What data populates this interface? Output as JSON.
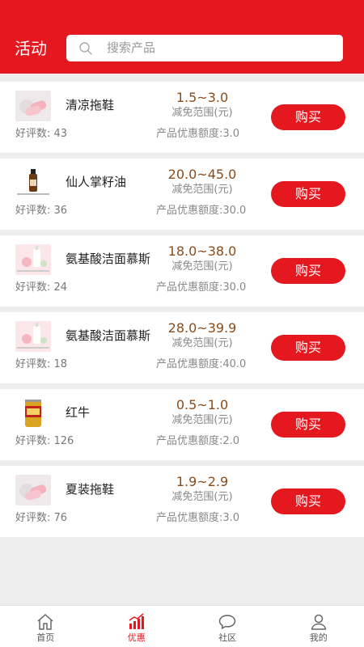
{
  "header": {
    "title": "活动",
    "search_placeholder": "搜索产品"
  },
  "colors": {
    "brand_red": "#e5171f",
    "price_brown": "#8a4b1a"
  },
  "products": [
    {
      "name": "清凉拖鞋",
      "rating": "好评数: 43",
      "range": "1.5~3.0",
      "range_label": "减免范围(元)",
      "discount": "产品优惠额度:3.0",
      "buy": "购买",
      "image": "slipper-image"
    },
    {
      "name": "仙人掌籽油",
      "rating": "好评数: 36",
      "range": "20.0~45.0",
      "range_label": "减免范围(元)",
      "discount": "产品优惠额度:30.0",
      "buy": "购买",
      "image": "oil-bottle-image"
    },
    {
      "name": "氨基酸洁面慕斯",
      "rating": "好评数: 24",
      "range": "18.0~38.0",
      "range_label": "减免范围(元)",
      "discount": "产品优惠额度:30.0",
      "buy": "购买",
      "image": "cleanser-image"
    },
    {
      "name": "氨基酸洁面慕斯",
      "rating": "好评数: 18",
      "range": "28.0~39.9",
      "range_label": "减免范围(元)",
      "discount": "产品优惠额度:40.0",
      "buy": "购买",
      "image": "cleanser-image"
    },
    {
      "name": "红牛",
      "rating": "好评数: 126",
      "range": "0.5~1.0",
      "range_label": "减免范围(元)",
      "discount": "产品优惠额度:2.0",
      "buy": "购买",
      "image": "energy-drink-can-image"
    },
    {
      "name": "夏装拖鞋",
      "rating": "好评数: 76",
      "range": "1.9~2.9",
      "range_label": "减免范围(元)",
      "discount": "产品优惠额度:3.0",
      "buy": "购买",
      "image": "slipper-image"
    }
  ],
  "tabbar": {
    "items": [
      {
        "label": "首页",
        "icon": "home-icon",
        "active": false
      },
      {
        "label": "优惠",
        "icon": "chart-icon",
        "active": true
      },
      {
        "label": "社区",
        "icon": "chat-icon",
        "active": false
      },
      {
        "label": "我的",
        "icon": "user-icon",
        "active": false
      }
    ]
  }
}
